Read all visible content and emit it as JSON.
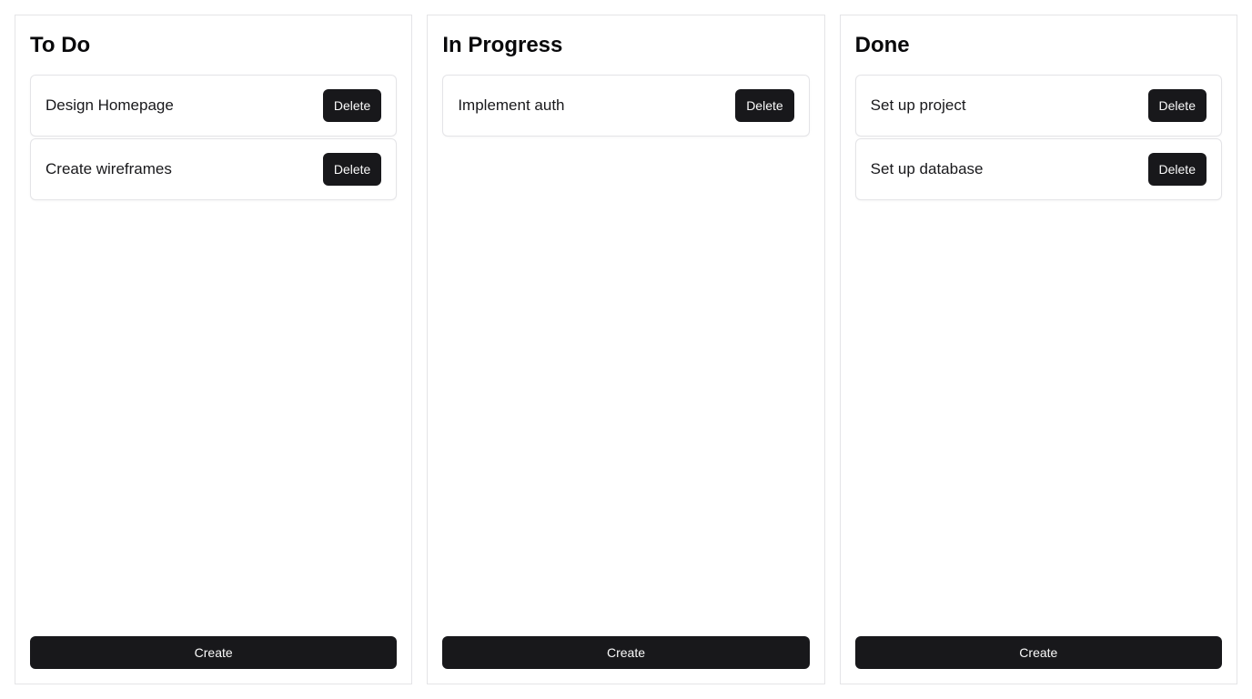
{
  "columns": [
    {
      "title": "To Do",
      "tasks": [
        {
          "label": "Design Homepage",
          "delete_label": "Delete"
        },
        {
          "label": "Create wireframes",
          "delete_label": "Delete"
        }
      ],
      "create_label": "Create"
    },
    {
      "title": "In Progress",
      "tasks": [
        {
          "label": "Implement auth",
          "delete_label": "Delete"
        }
      ],
      "create_label": "Create"
    },
    {
      "title": "Done",
      "tasks": [
        {
          "label": "Set up project",
          "delete_label": "Delete"
        },
        {
          "label": "Set up database",
          "delete_label": "Delete"
        }
      ],
      "create_label": "Create"
    }
  ],
  "colors": {
    "button_bg": "#18181b",
    "button_text": "#fafafa",
    "border": "#e4e4e7"
  }
}
